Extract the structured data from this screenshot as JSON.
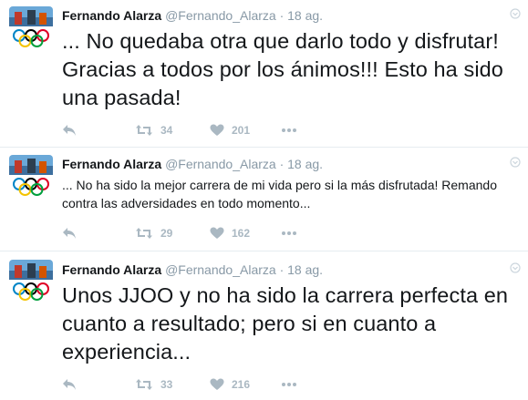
{
  "tweets": [
    {
      "name": "Fernando Alarza",
      "handle": "@Fernando_Alarza",
      "separator": "·",
      "time": "18 ag.",
      "text": "... No quedaba otra que darlo todo y disfrutar! Gracias a todos por los ánimos!!! Esto ha sido una pasada!",
      "retweets": "34",
      "likes": "201"
    },
    {
      "name": "Fernando Alarza",
      "handle": "@Fernando_Alarza",
      "separator": "·",
      "time": "18 ag.",
      "text": "... No ha sido la mejor carrera de mi vida pero si la más disfrutada! Remando contra las adversidades en todo momento...",
      "retweets": "29",
      "likes": "162"
    },
    {
      "name": "Fernando Alarza",
      "handle": "@Fernando_Alarza",
      "separator": "·",
      "time": "18 ag.",
      "text": "Unos JJOO y no ha sido la carrera perfecta en cuanto a resultado; pero si en cuanto a experiencia...",
      "retweets": "33",
      "likes": "216"
    }
  ],
  "icons": [
    "reply-icon",
    "retweet-icon",
    "like-icon",
    "more-icon",
    "caret-icon"
  ],
  "colors": {
    "action_gray": "#aab8c2",
    "meta_gray": "#8899a6",
    "text": "#14171a",
    "divider": "#e6ecf0",
    "ring_blue": "#0085c7",
    "ring_yellow": "#f4c300",
    "ring_black": "#000000",
    "ring_green": "#009f3d",
    "ring_red": "#df0024"
  }
}
